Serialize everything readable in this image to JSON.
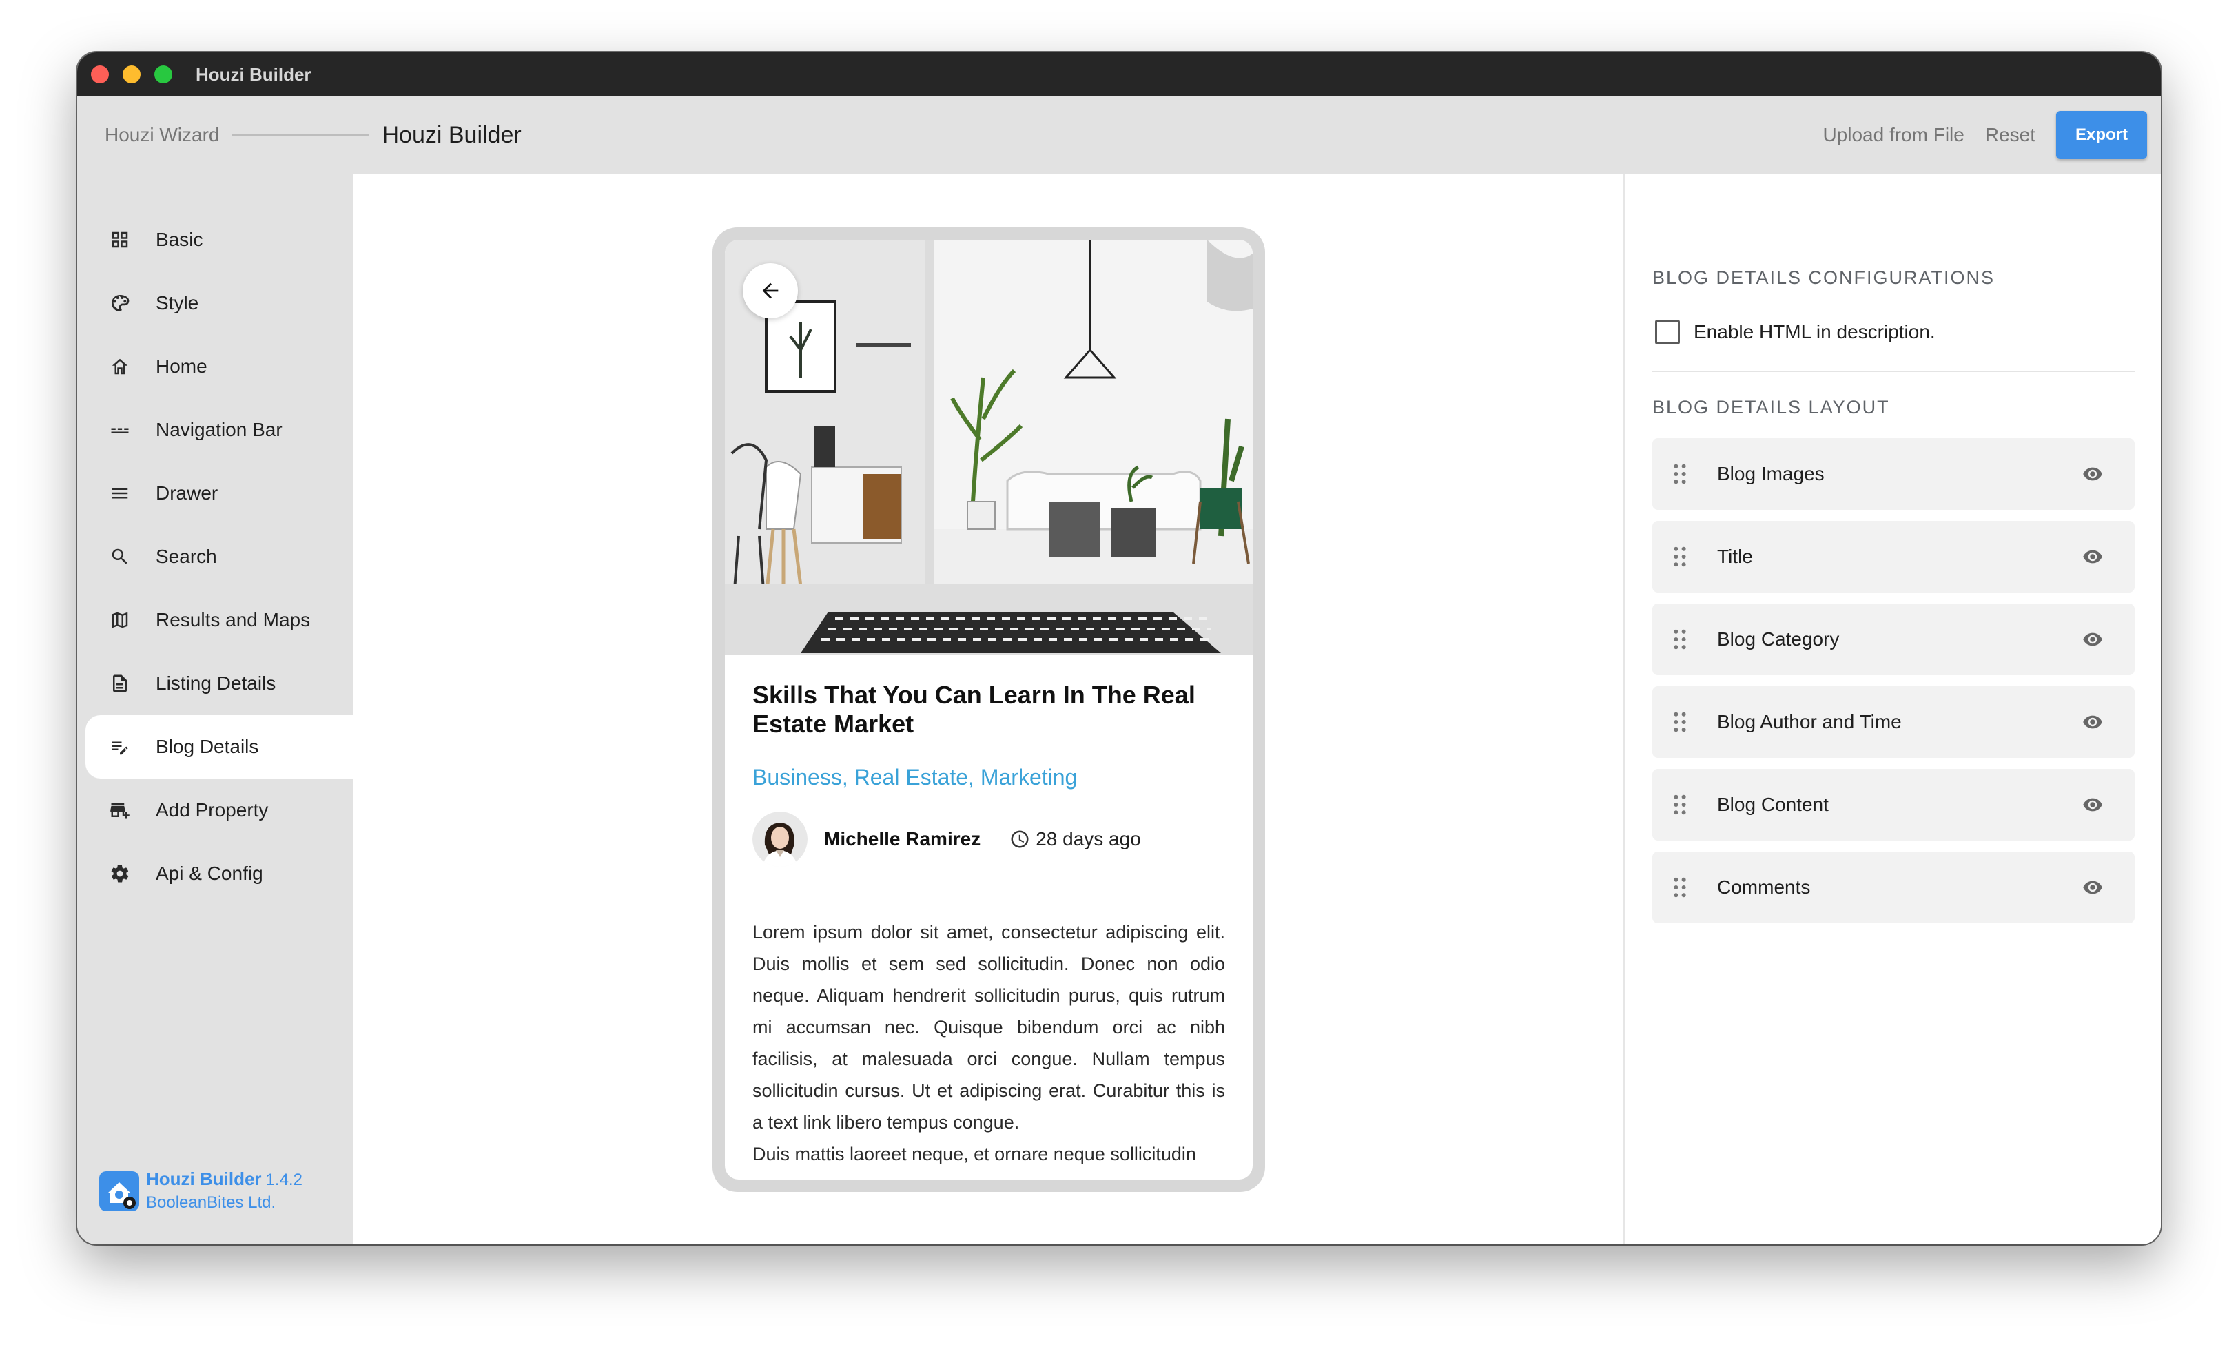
{
  "window": {
    "title": "Houzi Builder"
  },
  "header": {
    "wizard_label": "Houzi Wizard",
    "current_page": "Houzi Builder",
    "upload_label": "Upload from File",
    "reset_label": "Reset",
    "export_label": "Export"
  },
  "sidebar": {
    "items": [
      {
        "label": "Basic",
        "icon": "grid-icon"
      },
      {
        "label": "Style",
        "icon": "palette-icon"
      },
      {
        "label": "Home",
        "icon": "home-icon"
      },
      {
        "label": "Navigation Bar",
        "icon": "nav-bar-icon"
      },
      {
        "label": "Drawer",
        "icon": "menu-icon"
      },
      {
        "label": "Search",
        "icon": "search-icon"
      },
      {
        "label": "Results and Maps",
        "icon": "map-icon"
      },
      {
        "label": "Listing Details",
        "icon": "document-icon"
      },
      {
        "label": "Blog Details",
        "icon": "edit-list-icon",
        "active": true
      },
      {
        "label": "Add Property",
        "icon": "add-business-icon"
      },
      {
        "label": "Api & Config",
        "icon": "settings-icon"
      }
    ],
    "brand": {
      "name": "Houzi Builder",
      "version": "1.4.2",
      "company": "BooleanBites Ltd."
    }
  },
  "preview": {
    "title": "Skills That You Can Learn In The Real Estate Market",
    "categories": "Business, Real Estate, Marketing",
    "author": "Michelle Ramirez",
    "time_ago": "28 days ago",
    "body_p1": "Lorem ipsum dolor sit amet, consectetur adipiscing elit. Duis mollis et sem sed sollicitudin. Donec non odio neque. Aliquam hendrerit sollicitudin purus, quis rutrum mi accumsan nec. Quisque bibendum orci ac nibh facilisis, at malesuada orci congue. Nullam tempus sollicitudin cursus. Ut et adipiscing erat. Curabitur this is a text link libero tempus congue.",
    "body_p2": "Duis mattis laoreet neque, et ornare neque sollicitudin"
  },
  "config": {
    "section_title": "BLOG DETAILS CONFIGURATIONS",
    "enable_html_label": "Enable HTML in description.",
    "enable_html_checked": false,
    "layout_title": "BLOG DETAILS LAYOUT",
    "layout_items": [
      {
        "label": "Blog Images",
        "visible": true
      },
      {
        "label": "Title",
        "visible": true
      },
      {
        "label": "Blog Category",
        "visible": true
      },
      {
        "label": "Blog Author and Time",
        "visible": true
      },
      {
        "label": "Blog Content",
        "visible": true
      },
      {
        "label": "Comments",
        "visible": true
      }
    ]
  },
  "colors": {
    "accent": "#3d8fe8",
    "category_link": "#3aa2d8",
    "sidebar_bg": "#e2e2e2",
    "titlebar_bg": "#262626"
  }
}
